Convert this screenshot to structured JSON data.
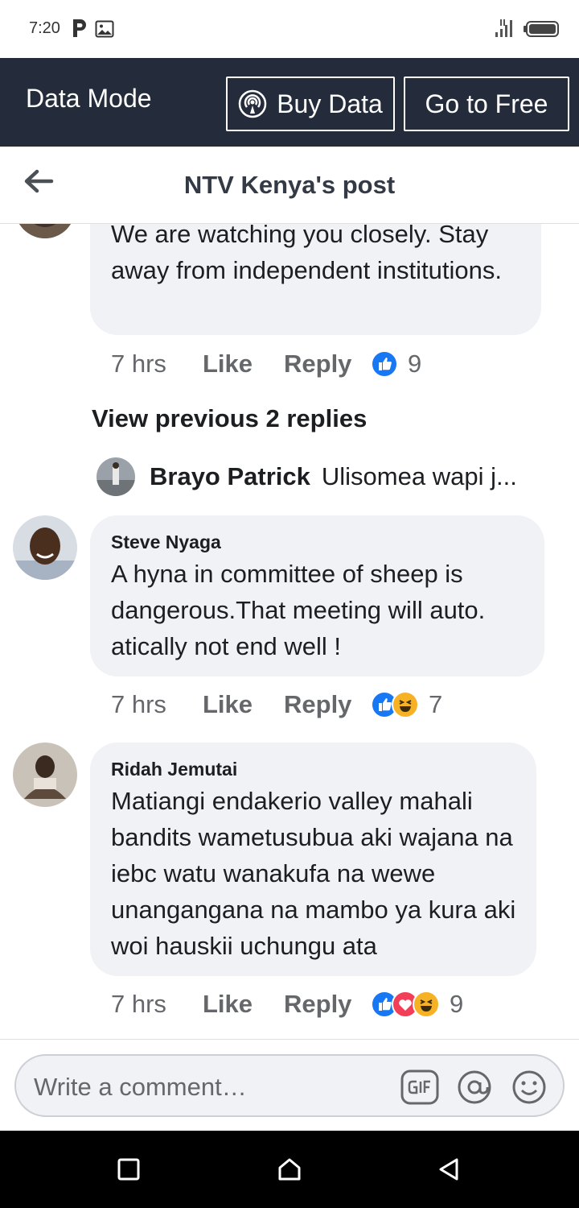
{
  "status_bar": {
    "time": "7:20",
    "icons": [
      "parking-p-icon",
      "image-icon",
      "signal-icon",
      "battery-icon"
    ]
  },
  "data_bar": {
    "mode_label": "Data Mode",
    "buy_label": "Buy Data",
    "free_label": "Go to Free",
    "background": "#242c3b"
  },
  "header": {
    "title": "NTV Kenya's post",
    "back_icon": "back-arrow-icon"
  },
  "top_comment": {
    "text": "We are watching you closely. Stay away from independent institutions.",
    "time": "7 hrs",
    "like": "Like",
    "reply": "Reply",
    "reactions": [
      "like"
    ],
    "count": "9"
  },
  "view_previous": "View previous 2 replies",
  "reply_preview": {
    "name": "Brayo Patrick",
    "text": "Ulisomea wapi j..."
  },
  "comments": [
    {
      "author": "Steve Nyaga",
      "text": "A hyna in committee of sheep is dangerous.That meeting will auto. atically not end well !",
      "time": "7 hrs",
      "like": "Like",
      "reply": "Reply",
      "reactions": [
        "like",
        "haha"
      ],
      "count": "7"
    },
    {
      "author": "Ridah Jemutai",
      "text": "Matiangi endakerio valley mahali bandits wametusubua aki wajana na iebc watu wanakufa na wewe unangangana na mambo ya kura aki woi hauskii uchungu ata",
      "time": "7 hrs",
      "like": "Like",
      "reply": "Reply",
      "reactions": [
        "like",
        "love",
        "haha"
      ],
      "count": "9"
    }
  ],
  "composer": {
    "placeholder": "Write a comment…",
    "icons": [
      "gif-icon",
      "mention-icon",
      "emoji-icon"
    ]
  },
  "nav": [
    "recents-square-icon",
    "home-icon",
    "back-triangle-icon"
  ],
  "colors": {
    "reaction_like": "#1877f2",
    "reaction_love": "#f33e58",
    "reaction_haha": "#f7b125",
    "bubble": "#f0f2f5",
    "muted_text": "#65676b"
  }
}
